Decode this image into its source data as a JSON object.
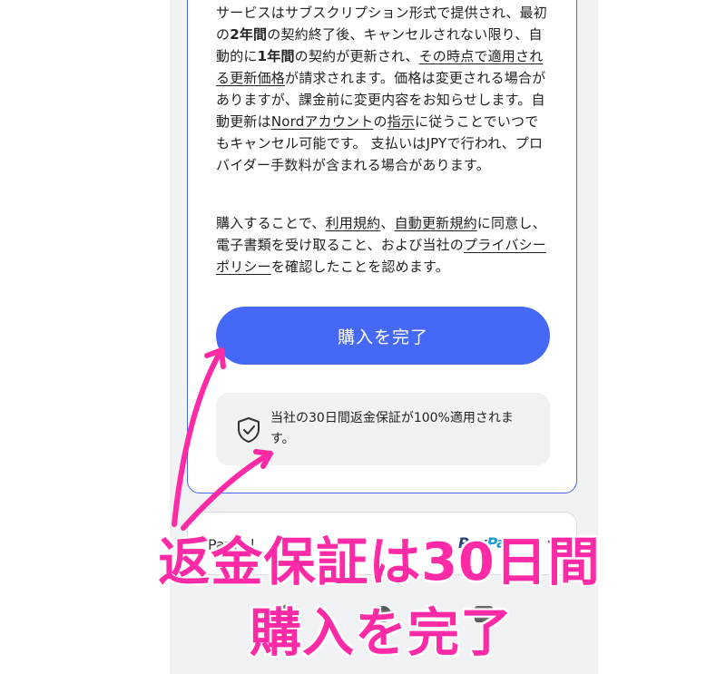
{
  "terms": {
    "p1_a": "サービスはサブスクリプション形式で提供され、最初の",
    "p1_b": "2年間",
    "p1_c": "の契約終了後、キャンセルされない限り、自動的に",
    "p1_d": "1年間",
    "p1_e": "の契約が更新され、",
    "p1_link1": "その時点で適用される更新価格",
    "p1_f": "が請求されます。価格は変更される場合がありますが、課金前に変更内容をお知らせします。自動更新は",
    "p1_link2": "Nordアカウント",
    "p1_g": "の",
    "p1_link3": "指示",
    "p1_h": "に従うことでいつでもキャンセル可能です。 支払いはJPYで行われ、プロバイダー手数料が含まれる場合があります。",
    "p2_a": "購入することで、",
    "p2_link1": "利用規約",
    "p2_b": "、",
    "p2_link2": "自動更新規約",
    "p2_c": "に同意し、電子書類を受け取ること、および当社の",
    "p2_link3": "プライバシーポリシー",
    "p2_d": "を確認したことを認めます。"
  },
  "cta": {
    "label": "購入を完了"
  },
  "guarantee": {
    "text": "当社の30日間返金保証が100%適用されます。",
    "icon": "shield-check-icon"
  },
  "payment": {
    "label": "PayPal",
    "logo_a": "Pay",
    "logo_b": "Pal"
  },
  "annotations": {
    "line1": "返金保証は30日間",
    "line2": "購入を完了"
  },
  "colors": {
    "accent": "#4568f6",
    "annotation": "#ff2aa6"
  }
}
